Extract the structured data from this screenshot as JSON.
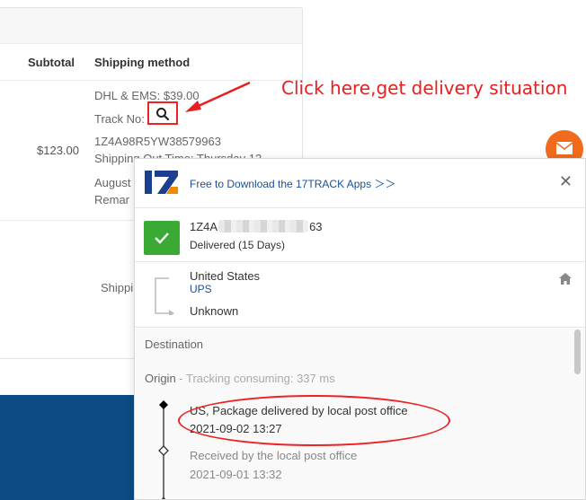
{
  "order": {
    "col_subtotal": "Subtotal",
    "col_shipping": "Shipping method",
    "price": "$123.00",
    "line1": "DHL & EMS: $39.00",
    "line2": "Track No:",
    "line3": "1Z4A98R5YW38579963",
    "line4": "Shipping Out Time: Thursday 12",
    "line5": "August",
    "line6": "Remar",
    "shipping_label": "Shippi"
  },
  "annotation": {
    "text": "Click here,get delivery situation",
    "color": "#e81f1f"
  },
  "popup": {
    "download_link": "Free to Download the 17TRACK Apps ＞＞",
    "close_icon": "close-icon",
    "tracking_prefix": "1Z4A",
    "tracking_suffix": "63",
    "status": "Delivered (15 Days)",
    "origin_country": "United States",
    "carrier": "UPS",
    "destination_country": "Unknown",
    "destination_label": "Destination",
    "origin_label": "Origin",
    "origin_note": " - Tracking consuming: 337 ms",
    "events": [
      {
        "text": "US, Package delivered by local post office",
        "time": "2021-09-02 13:27"
      },
      {
        "text": "Received by the local post office",
        "time": "2021-09-01 13:32"
      }
    ]
  },
  "colors": {
    "footer": "#0d4b85",
    "mail_button": "#f26b1d",
    "delivered": "#3aaa35",
    "link": "#1a4f9c"
  }
}
